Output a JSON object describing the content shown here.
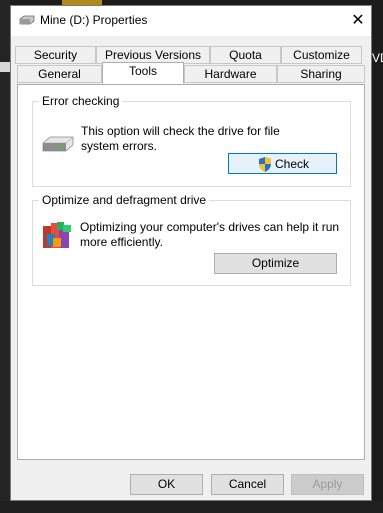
{
  "window": {
    "title": "Mine (D:) Properties"
  },
  "background": {
    "right_text": "VD"
  },
  "tabs": {
    "row1": [
      "Security",
      "Previous Versions",
      "Quota",
      "Customize"
    ],
    "row2": [
      "General",
      "Tools",
      "Hardware",
      "Sharing"
    ],
    "active": "Tools"
  },
  "error_checking": {
    "title": "Error checking",
    "description": "This option will check the drive for file system errors.",
    "button_label": "Check"
  },
  "optimize": {
    "title": "Optimize and defragment drive",
    "description": "Optimizing your computer's drives can help it run more efficiently.",
    "button_label": "Optimize"
  },
  "footer": {
    "ok_label": "OK",
    "cancel_label": "Cancel",
    "apply_label": "Apply"
  },
  "colors": {
    "focus_border": "#0078d7",
    "window_bg": "#f0f0f0",
    "panel_bg": "#ffffff"
  }
}
